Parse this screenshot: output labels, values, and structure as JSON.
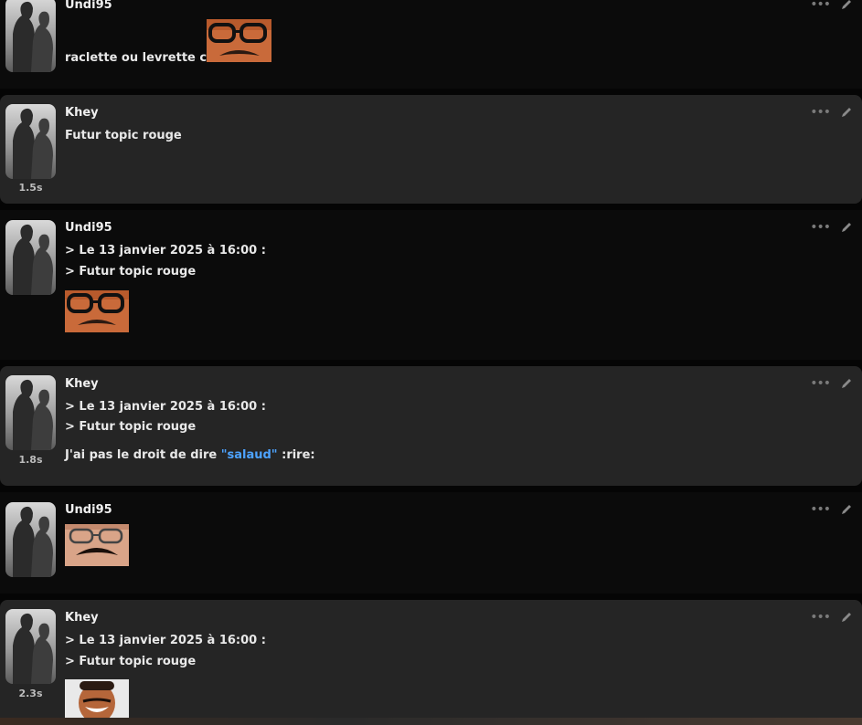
{
  "posts": [
    {
      "author": "Undi95",
      "body_lines": [
        "raclette ou levrette clé ?"
      ],
      "latency": "",
      "sticker": "glasses-face"
    },
    {
      "author": "Khey",
      "body_lines": [
        "Futur topic rouge"
      ],
      "latency": "1.5s"
    },
    {
      "author": "Undi95",
      "quote": [
        "> Le 13 janvier 2025 à 16:00 :",
        "> Futur topic rouge"
      ],
      "latency": "",
      "sticker": "glasses-face"
    },
    {
      "author": "Khey",
      "quote": [
        "> Le 13 janvier 2025 à 16:00 :",
        "> Futur topic rouge"
      ],
      "reply_prefix": "J'ai pas le droit de dire ",
      "reply_highlight": "\"salaud\"",
      "reply_suffix": " :rire:",
      "latency": "1.8s"
    },
    {
      "author": "Undi95",
      "latency": "",
      "sticker": "mustache-face"
    },
    {
      "author": "Khey",
      "quote": [
        "> Le 13 janvier 2025 à 16:00 :",
        "> Futur topic rouge"
      ],
      "latency": "2.3s",
      "sticker": "laughing-face"
    }
  ],
  "icons": {
    "more": "more-dots-icon",
    "edit": "pencil-icon"
  },
  "colors": {
    "highlight": "#4da3ff",
    "card_light": "#252525",
    "card_dark": "#0b0b0b"
  }
}
